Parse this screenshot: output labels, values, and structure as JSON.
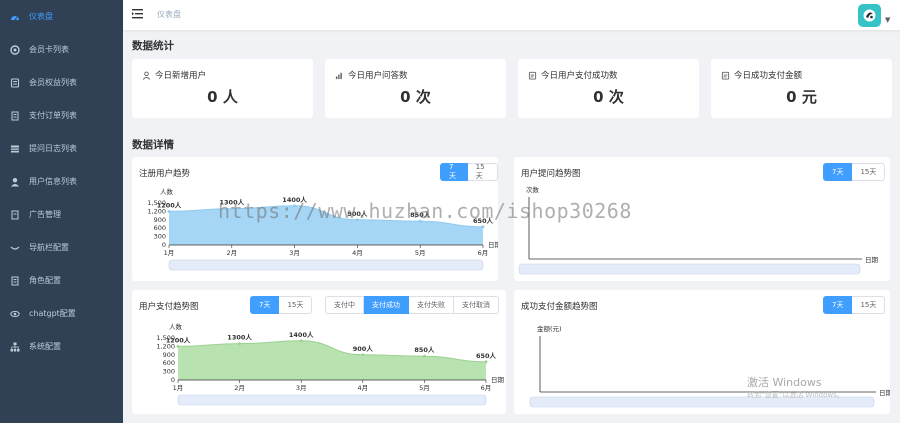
{
  "sidebar": {
    "items": [
      {
        "label": "仪表盘",
        "icon": "dashboard-icon",
        "active": true
      },
      {
        "label": "会员卡列表",
        "icon": "card-icon"
      },
      {
        "label": "会员权益列表",
        "icon": "rights-icon"
      },
      {
        "label": "支付订单列表",
        "icon": "order-icon"
      },
      {
        "label": "提问日志列表",
        "icon": "log-icon"
      },
      {
        "label": "用户信息列表",
        "icon": "user-icon"
      },
      {
        "label": "广告管理",
        "icon": "ad-icon"
      },
      {
        "label": "导航栏配置",
        "icon": "nav-icon"
      },
      {
        "label": "角色配置",
        "icon": "role-icon"
      },
      {
        "label": "chatgpt配置",
        "icon": "eye-icon"
      },
      {
        "label": "系统配置",
        "icon": "tree-icon"
      }
    ]
  },
  "header": {
    "breadcrumb": "仪表盘"
  },
  "stats_title": "数据统计",
  "stats": [
    {
      "label": "今日新增用户",
      "value": "0 人",
      "icon": "user-icon"
    },
    {
      "label": "今日用户问答数",
      "value": "0 次",
      "icon": "signal-icon"
    },
    {
      "label": "今日用户支付成功数",
      "value": "0 次",
      "icon": "calendar-icon"
    },
    {
      "label": "今日成功支付金额",
      "value": "0 元",
      "icon": "calendar-icon"
    }
  ],
  "details_title": "数据详情",
  "range_buttons": [
    "7天",
    "15天"
  ],
  "pay_status_buttons": [
    "支付中",
    "支付成功",
    "支付失败",
    "支付取消"
  ],
  "panels": {
    "register": {
      "title": "注册用户趋势"
    },
    "ask": {
      "title": "用户提问趋势图"
    },
    "pay": {
      "title": "用户支付趋势图"
    },
    "amount": {
      "title": "成功支付金额趋势图"
    }
  },
  "watermark": "https://www.huzhan.com/ishop30268",
  "windows_watermark": {
    "line1": "激活 Windows",
    "line2": "转到“设置”以激活 Windows。"
  },
  "colors": {
    "accent": "#409eff",
    "sidebar": "#304156",
    "area_blue": "#a6d6f5",
    "area_green": "#b8e2b0"
  },
  "chart_data": [
    {
      "type": "area",
      "title": "注册用户趋势",
      "ylabel": "人数",
      "xlabel": "日期",
      "x": [
        "1月",
        "2月",
        "3月",
        "4月",
        "5月",
        "6月"
      ],
      "y_ticks": [
        "0",
        "300",
        "600",
        "900",
        "1,200",
        "1,500"
      ],
      "ylim": [
        0,
        1500
      ],
      "series": [
        {
          "values": [
            1200,
            1300,
            1400,
            900,
            850,
            650
          ]
        }
      ],
      "labels": [
        "1200人",
        "1300人",
        "1400人",
        "900人",
        "850人",
        "650人"
      ]
    },
    {
      "type": "line",
      "title": "用户提问趋势图",
      "ylabel": "次数",
      "xlabel": "日期",
      "x": [],
      "series": []
    },
    {
      "type": "area",
      "title": "用户支付趋势图",
      "ylabel": "人数",
      "xlabel": "日期",
      "x": [
        "1月",
        "2月",
        "3月",
        "4月",
        "5月",
        "6月"
      ],
      "y_ticks": [
        "0",
        "300",
        "600",
        "900",
        "1,200",
        "1,500"
      ],
      "ylim": [
        0,
        1500
      ],
      "series": [
        {
          "values": [
            1200,
            1300,
            1400,
            900,
            850,
            650
          ]
        }
      ],
      "labels": [
        "1200人",
        "1300人",
        "1400人",
        "900人",
        "850人",
        "650人"
      ]
    },
    {
      "type": "line",
      "title": "成功支付金额趋势图",
      "ylabel": "金额(元)",
      "xlabel": "日期",
      "x": [],
      "series": []
    }
  ]
}
